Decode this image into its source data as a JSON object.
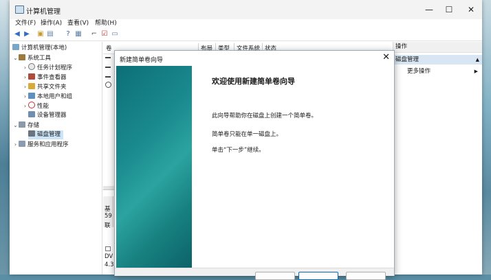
{
  "app": {
    "title": "计算机管理"
  },
  "window_controls": {
    "minimize": "—",
    "maximize": "☐",
    "close": "✕"
  },
  "menu": [
    "文件(F)",
    "操作(A)",
    "查看(V)",
    "帮助(H)"
  ],
  "tree": {
    "root": "计算机管理(本地)",
    "system_tools": "系统工具",
    "task_scheduler": "任务计划程序",
    "event_viewer": "事件查看器",
    "shared_folders": "共享文件夹",
    "local_users": "本地用户和组",
    "performance": "性能",
    "device_manager": "设备管理器",
    "storage": "存储",
    "disk_management": "磁盘管理",
    "services_apps": "服务和应用程序"
  },
  "volume_table": {
    "headers": [
      "卷",
      "布局",
      "类型",
      "文件系统",
      "状态"
    ]
  },
  "disk_panel": {
    "disk0_line1": "基",
    "disk0_line2": "59",
    "disk0_line3": "联",
    "dvd_line1": "DV",
    "dvd_line2": "4.3"
  },
  "actions_pane": {
    "header": "操作",
    "section": "磁盘管理",
    "more": "更多操作"
  },
  "wizard": {
    "title": "新建简单卷向导",
    "close": "✕",
    "heading": "欢迎使用新建简单卷向导",
    "line1": "此向导帮助你在磁盘上创建一个简单卷。",
    "line2": "简单卷只能在单一磁盘上。",
    "line3": "单击“下一步”继续。"
  },
  "colors": {
    "selection": "#cce4f7",
    "banner": "#1a8a8f",
    "primary_button_border": "#0067c0"
  }
}
